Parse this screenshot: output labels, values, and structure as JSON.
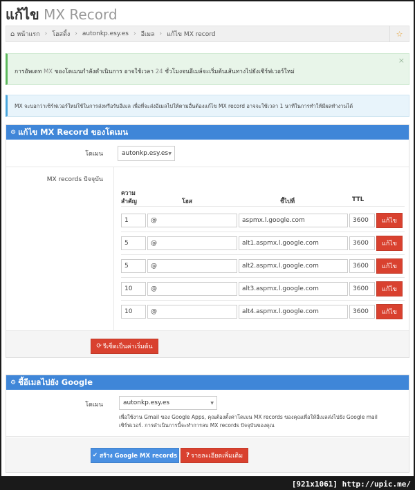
{
  "page": {
    "title_bold": "แก้ไข",
    "title_light": "MX Record"
  },
  "breadcrumb": {
    "home": "หน้าแรก",
    "hosting": "โฮสติ้ง",
    "domain": "autonkp.esy.es",
    "email": "อีเมล",
    "current": "แก้ไข MX record"
  },
  "alerts": {
    "success_pre": "การอัพเดท",
    "success_mx": "MX",
    "success_mid": "ของโดเมนกำลังดำเนินการ อาจใช้เวลา",
    "success_hours": "24",
    "success_post": "ชั่วโมงจนอีเมล์จะเริ่มต้นเส้นทางไปยังเซิร์ฟเวอร์ใหม่",
    "close_symbol": "×",
    "info": "MX จะบอกว่าเซิร์ฟเวอร์ใหม่ใช้ในการส่งหรือรับอีเมล เพื่อที่จะส่งอีเมลไปให้ตามอื่นต้องแก้ไข MX record อาจจะใช้เวลา 1 นาทีในการทำให้มีผลทำงานได้"
  },
  "panel1": {
    "heading": "แก้ไข MX Record ของโดเมน",
    "domain_label": "โดเมน",
    "domain_value": "autonkp.esy.es",
    "records_label": "MX records ปัจจุบัน",
    "col_priority_1": "ความ",
    "col_priority_2": "สำคัญ",
    "col_host": "โฮส",
    "col_target": "ชี้ไปที่",
    "col_ttl": "TTL",
    "records": [
      {
        "priority": "1",
        "host": "@",
        "target": "aspmx.l.google.com",
        "ttl": "3600",
        "button": "แก้ไข"
      },
      {
        "priority": "5",
        "host": "@",
        "target": "alt1.aspmx.l.google.com",
        "ttl": "3600",
        "button": "แก้ไข"
      },
      {
        "priority": "5",
        "host": "@",
        "target": "alt2.aspmx.l.google.com",
        "ttl": "3600",
        "button": "แก้ไข"
      },
      {
        "priority": "10",
        "host": "@",
        "target": "alt3.aspmx.l.google.com",
        "ttl": "3600",
        "button": "แก้ไข"
      },
      {
        "priority": "10",
        "host": "@",
        "target": "alt4.aspmx.l.google.com",
        "ttl": "3600",
        "button": "แก้ไข"
      }
    ],
    "reset_button": "รีเซ็ตเป็นค่าเริ่มต้น"
  },
  "panel2": {
    "heading": "ชี้อีเมลไปยัง Google",
    "domain_label": "โดเมน",
    "domain_value": "autonkp.esy.es",
    "help_1": "เพื่อใช้งาน Gmail ของ Google Apps, คุณต้องตั้งค่าโดเมน MX records ของคุณเพื่อให้อีเมลส่งไปยัง Google mail",
    "help_2": "เซิร์ฟเวอร์. การดำเนินการนี้จะทำการลบ MX records ปัจจุบันของคุณ",
    "create_button": "สร้าง Google MX records",
    "details_button": "รายละเอียดเพิ่มเติม"
  },
  "watermark": "[921x1061] http://upic.me/"
}
